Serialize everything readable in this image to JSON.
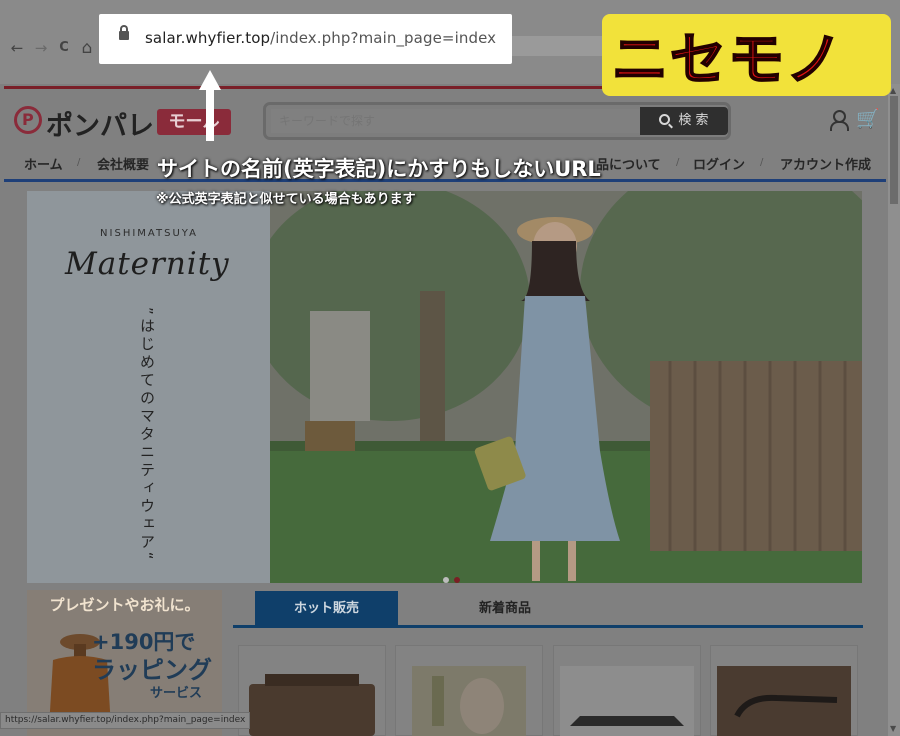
{
  "browser": {
    "url_domain": "salar.whyfier.top",
    "url_path": "/index.php?main_page=index",
    "back_icon": "←",
    "forward_icon": "→",
    "reload_icon": "C",
    "home_icon": "⌂"
  },
  "site": {
    "logo_mark": "P",
    "logo_text": "ポンパレ",
    "logo_badge": "モール",
    "search_placeholder": "キーワードで探す",
    "search_button": "検 索",
    "cart_icon": "🛒",
    "nav": [
      {
        "label": "ホーム"
      },
      {
        "label": "会社概要"
      },
      {
        "label": "品について"
      },
      {
        "label": "ログイン"
      },
      {
        "label": "アカウント作成"
      }
    ]
  },
  "banner": {
    "brand": "NISHIMATSUYA",
    "title": "Maternity",
    "vertical_text": "”はじめてのマタニティウェア“"
  },
  "promo": {
    "top": "プレゼントやお礼に。",
    "price": "+190円で",
    "wrapping": "ラッピング",
    "service": "サービス"
  },
  "tabs": [
    {
      "label": "ホット販売",
      "active": true
    },
    {
      "label": "新着商品",
      "active": false
    }
  ],
  "status_bar": "https://salar.whyfier.top/index.php?main_page=index",
  "annotations": {
    "fake_label": "ニセモノ",
    "main": "サイトの名前(英字表記)にかすりもしないURL",
    "sub": "※公式英字表記と似せている場合もあります"
  },
  "colors": {
    "fake_label_bg": "#f2e23a",
    "fake_label_text": "#e21212",
    "tab_active": "#0f3f6a",
    "brand": "#8a2b3a"
  }
}
